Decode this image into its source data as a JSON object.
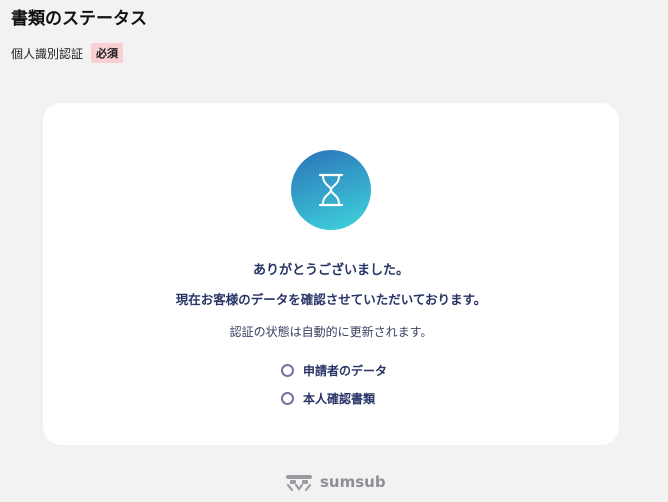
{
  "header": {
    "title": "書類のステータス"
  },
  "requirement": {
    "label": "個人識別認証",
    "badge": "必須"
  },
  "card": {
    "status_icon": "hourglass-icon",
    "thanks_message": "ありがとうございました。",
    "checking_message": "現在お客様のデータを確認させていただいております。",
    "auto_update_message": "認証の状態は自動的に更新されます。",
    "steps": [
      {
        "label": "申請者のデータ",
        "icon": "pending-circle-icon"
      },
      {
        "label": "本人確認書類",
        "icon": "pending-circle-icon"
      }
    ]
  },
  "footer": {
    "brand": "sumsub",
    "logo_icon": "sumsub-logo-icon"
  },
  "colors": {
    "background": "#f2f2f2",
    "card": "#ffffff",
    "badge": "#f8cfd3",
    "text_primary": "#283566",
    "gradient_start": "#2a72b8",
    "gradient_end": "#3fd6dc"
  }
}
